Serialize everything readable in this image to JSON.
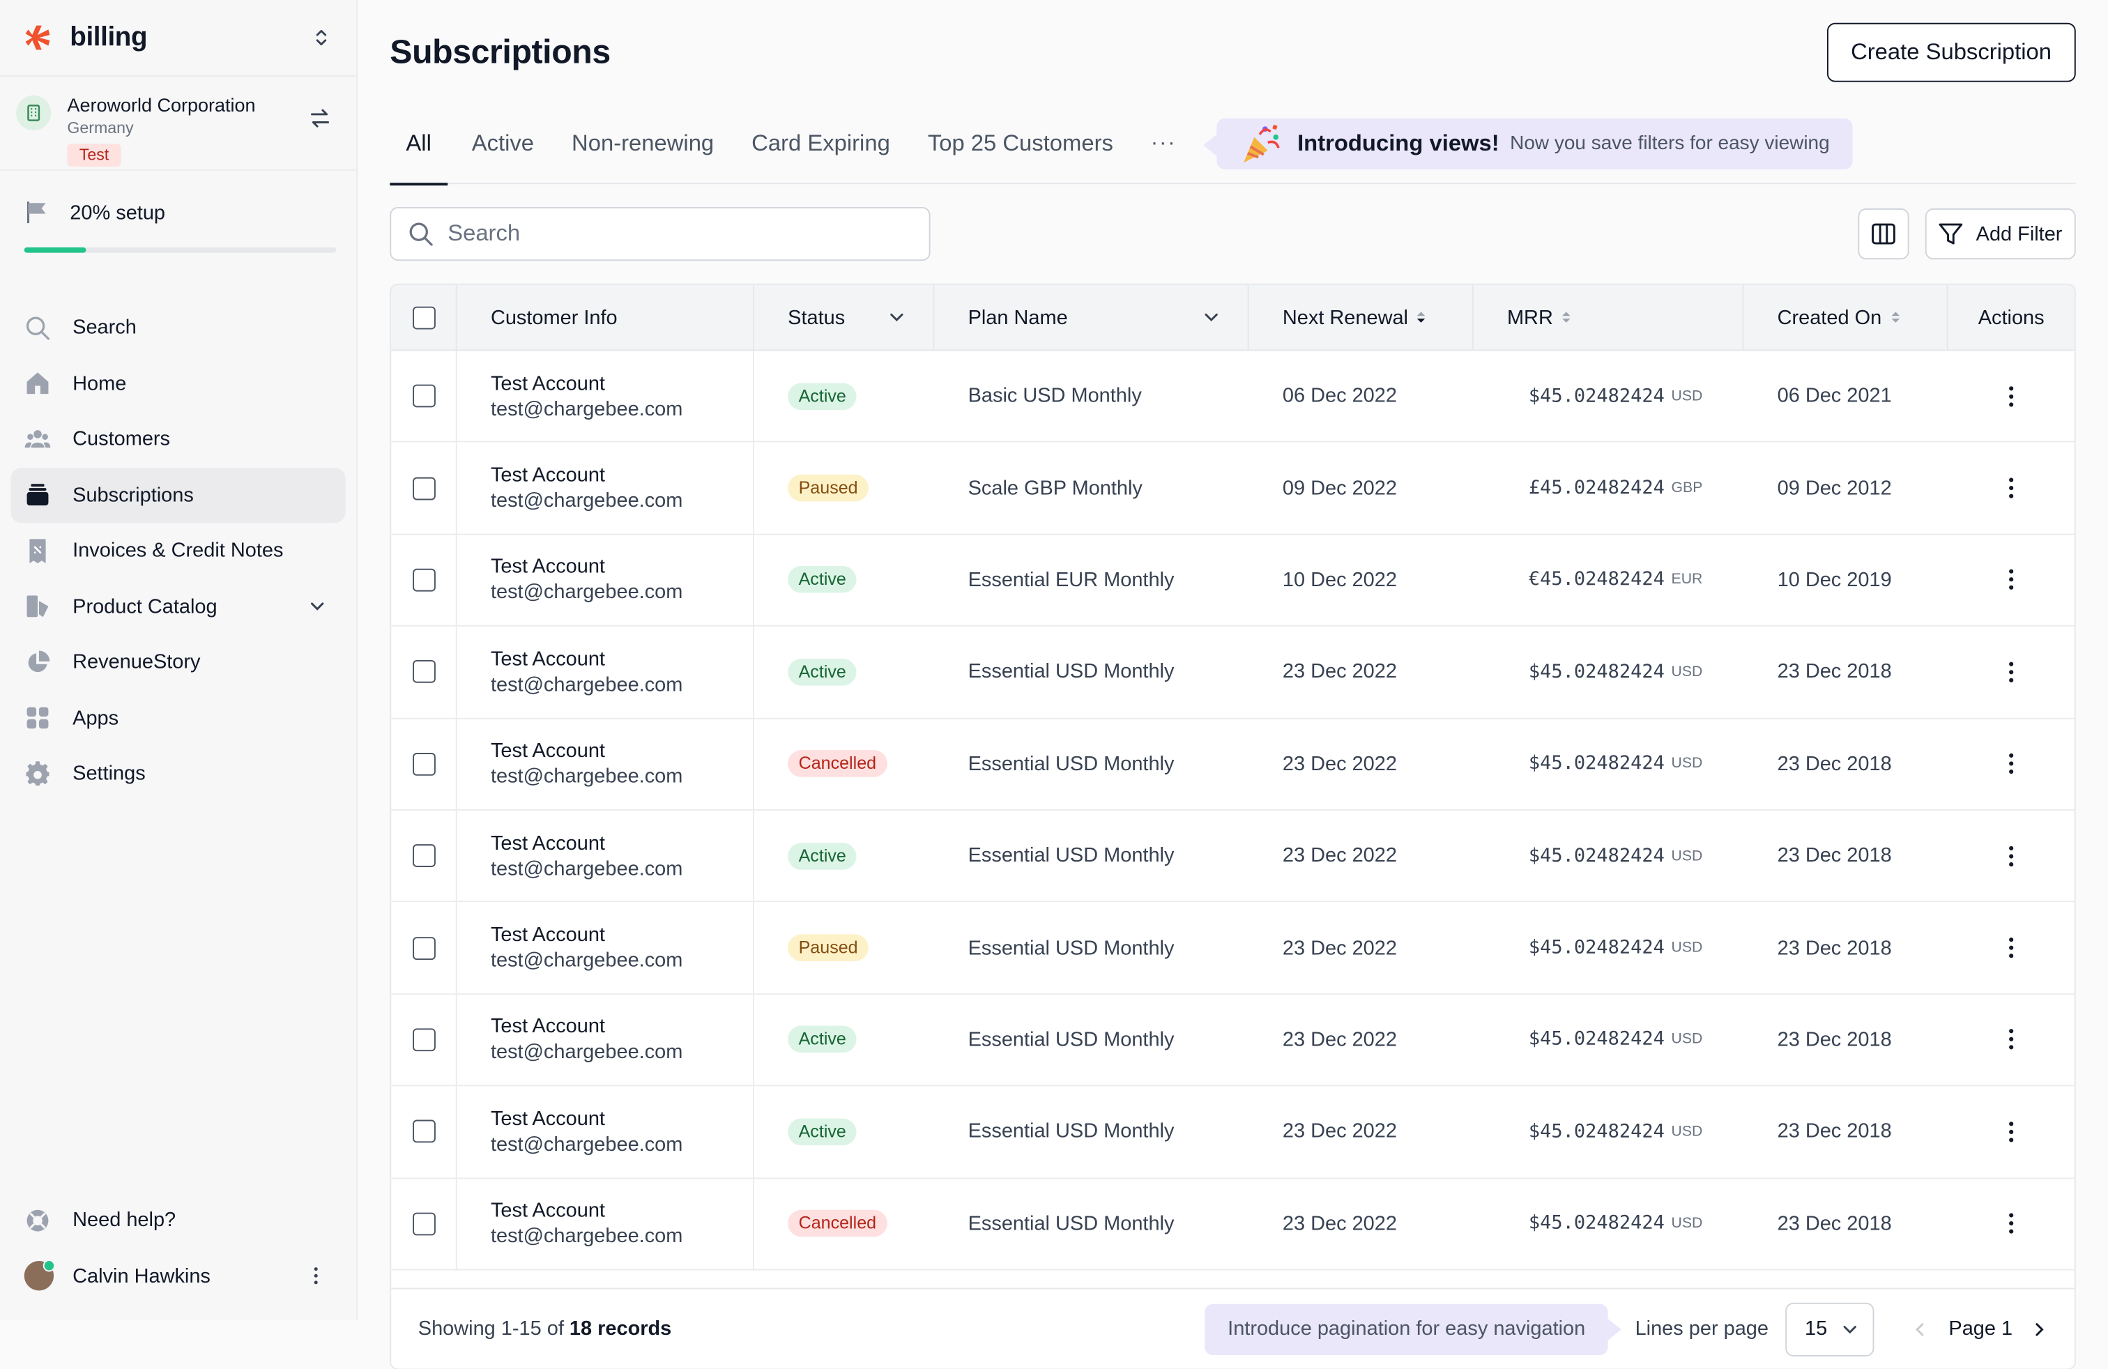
{
  "brand": {
    "name": "billing"
  },
  "org": {
    "name": "Aeroworld Corporation",
    "country": "Germany",
    "badge": "Test"
  },
  "setup": {
    "label": "20% setup",
    "progress": 0.2
  },
  "nav": [
    {
      "label": "Search",
      "icon": "search-icon"
    },
    {
      "label": "Home",
      "icon": "home-icon"
    },
    {
      "label": "Customers",
      "icon": "customers-icon"
    },
    {
      "label": "Subscriptions",
      "icon": "subscriptions-icon",
      "active": true
    },
    {
      "label": "Invoices & Credit Notes",
      "icon": "invoice-icon"
    },
    {
      "label": "Product Catalog",
      "icon": "catalog-icon",
      "expandable": true
    },
    {
      "label": "RevenueStory",
      "icon": "pie-chart-icon"
    },
    {
      "label": "Apps",
      "icon": "apps-icon"
    },
    {
      "label": "Settings",
      "icon": "gear-icon"
    }
  ],
  "bottom_nav": {
    "help": "Need help?",
    "user": "Calvin Hawkins"
  },
  "header": {
    "title": "Subscriptions",
    "create_button": "Create Subscription"
  },
  "tabs": [
    "All",
    "Active",
    "Non-renewing",
    "Card Expiring",
    "Top 25 Customers"
  ],
  "tabs_more": "···",
  "promo": {
    "strong": "Introducing views!",
    "text": "Now you save filters for easy viewing"
  },
  "search": {
    "placeholder": "Search",
    "value": ""
  },
  "toolbar": {
    "add_filter": "Add Filter"
  },
  "table": {
    "columns": [
      "Customer Info",
      "Status",
      "Plan Name",
      "Next Renewal",
      "MRR",
      "Created On",
      "Actions"
    ],
    "rows": [
      {
        "name": "Test Account",
        "email": "test@chargebee.com",
        "status": "Active",
        "plan": "Basic USD Monthly",
        "renewal": "06 Dec 2022",
        "mrr": "$45.02482424",
        "currency": "USD",
        "created": "06 Dec 2021"
      },
      {
        "name": "Test Account",
        "email": "test@chargebee.com",
        "status": "Paused",
        "plan": "Scale GBP Monthly",
        "renewal": "09 Dec 2022",
        "mrr": "£45.02482424",
        "currency": "GBP",
        "created": "09 Dec 2012"
      },
      {
        "name": "Test Account",
        "email": "test@chargebee.com",
        "status": "Active",
        "plan": "Essential EUR Monthly",
        "renewal": "10 Dec 2022",
        "mrr": "€45.02482424",
        "currency": "EUR",
        "created": "10 Dec 2019"
      },
      {
        "name": "Test Account",
        "email": "test@chargebee.com",
        "status": "Active",
        "plan": "Essential USD Monthly",
        "renewal": "23 Dec 2022",
        "mrr": "$45.02482424",
        "currency": "USD",
        "created": "23 Dec 2018"
      },
      {
        "name": "Test Account",
        "email": "test@chargebee.com",
        "status": "Cancelled",
        "plan": "Essential USD Monthly",
        "renewal": "23 Dec 2022",
        "mrr": "$45.02482424",
        "currency": "USD",
        "created": "23 Dec 2018"
      },
      {
        "name": "Test Account",
        "email": "test@chargebee.com",
        "status": "Active",
        "plan": "Essential USD Monthly",
        "renewal": "23 Dec 2022",
        "mrr": "$45.02482424",
        "currency": "USD",
        "created": "23 Dec 2018"
      },
      {
        "name": "Test Account",
        "email": "test@chargebee.com",
        "status": "Paused",
        "plan": "Essential USD Monthly",
        "renewal": "23 Dec 2022",
        "mrr": "$45.02482424",
        "currency": "USD",
        "created": "23 Dec 2018"
      },
      {
        "name": "Test Account",
        "email": "test@chargebee.com",
        "status": "Active",
        "plan": "Essential USD Monthly",
        "renewal": "23 Dec 2022",
        "mrr": "$45.02482424",
        "currency": "USD",
        "created": "23 Dec 2018"
      },
      {
        "name": "Test Account",
        "email": "test@chargebee.com",
        "status": "Active",
        "plan": "Essential USD Monthly",
        "renewal": "23 Dec 2022",
        "mrr": "$45.02482424",
        "currency": "USD",
        "created": "23 Dec 2018"
      },
      {
        "name": "Test Account",
        "email": "test@chargebee.com",
        "status": "Cancelled",
        "plan": "Essential USD Monthly",
        "renewal": "23 Dec 2022",
        "mrr": "$45.02482424",
        "currency": "USD",
        "created": "23 Dec 2018"
      }
    ]
  },
  "footer": {
    "showing_prefix": "Showing 1-15 of",
    "showing_count": "18 records",
    "pagination_promo": "Introduce pagination for easy navigation",
    "lines_label": "Lines per page",
    "lines_value": "15",
    "page_label": "Page 1"
  },
  "colors": {
    "brand": "#f0522d",
    "progress": "#22c48a",
    "promo_bg": "#ebe7fb"
  }
}
